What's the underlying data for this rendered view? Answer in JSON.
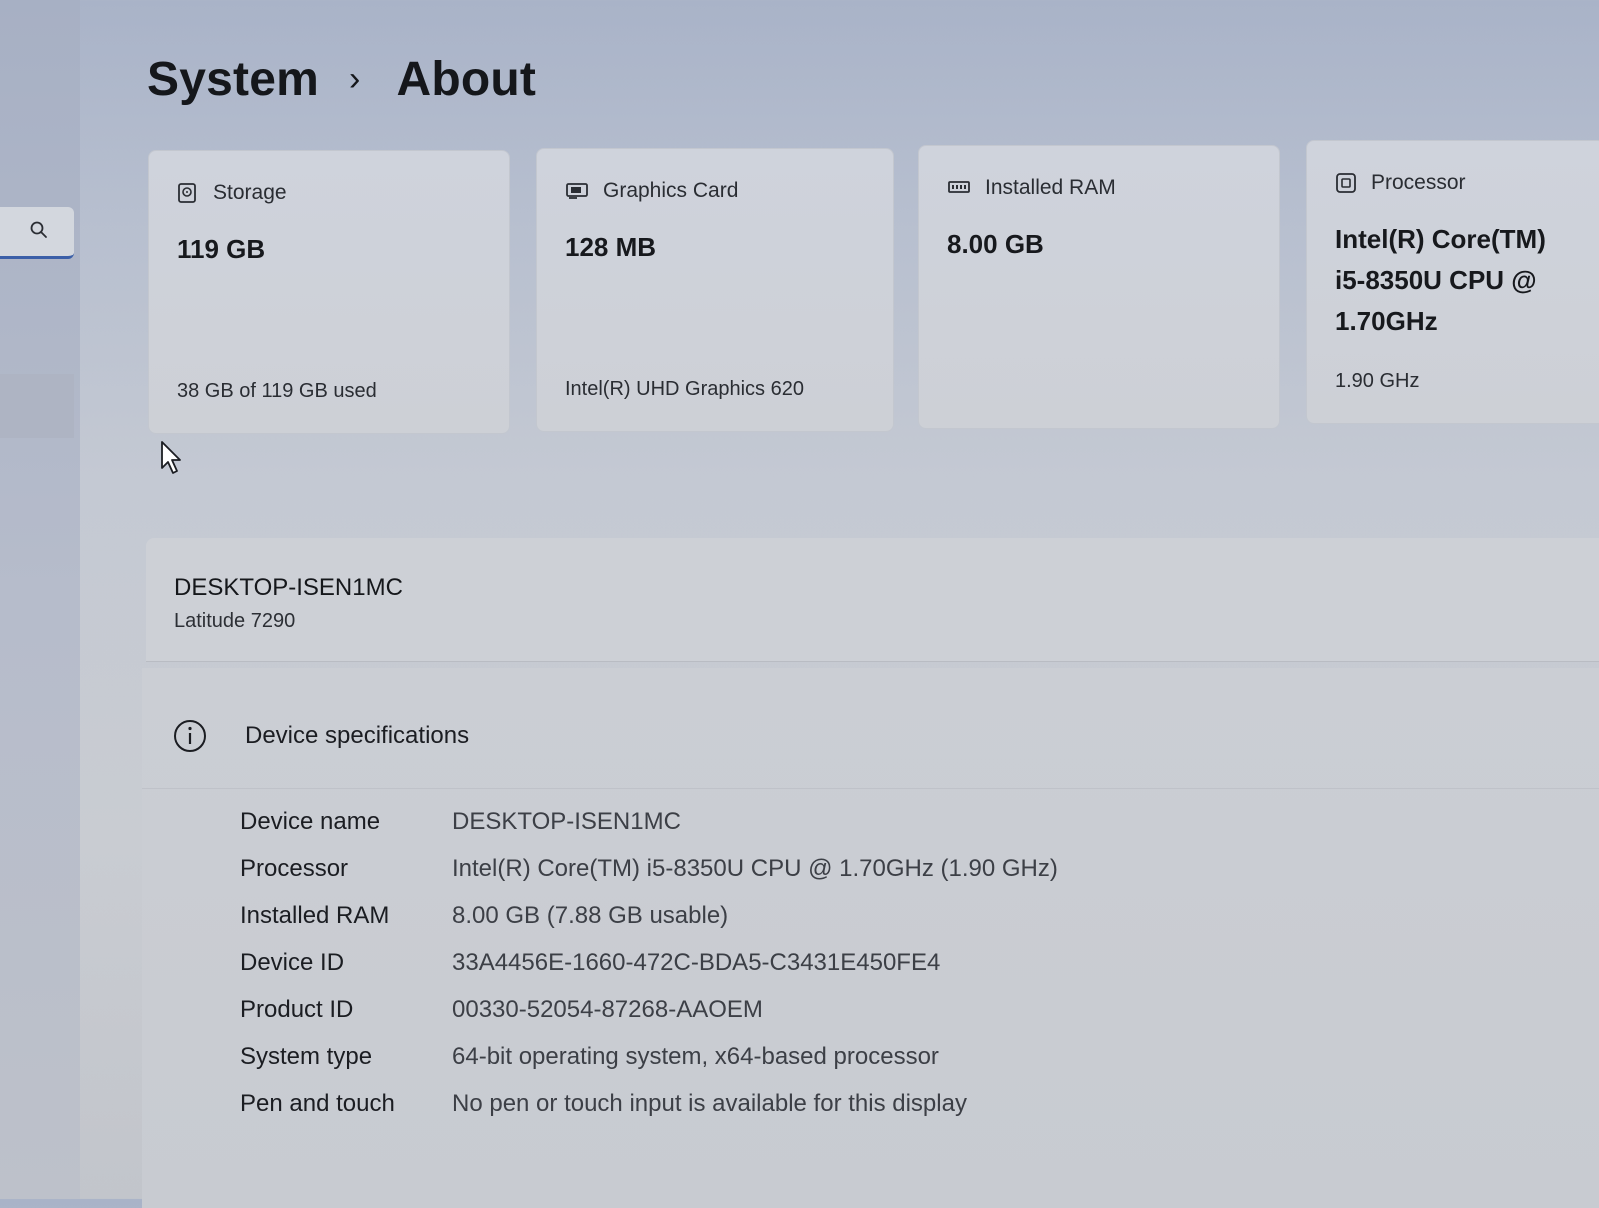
{
  "breadcrumb": {
    "parent": "System",
    "separator": "›",
    "current": "About"
  },
  "cards": {
    "storage": {
      "label": "Storage",
      "value": "119 GB",
      "sub": "38 GB of 119 GB used",
      "icon": "storage-icon"
    },
    "graphics": {
      "label": "Graphics Card",
      "value": "128 MB",
      "sub": "Intel(R) UHD Graphics 620",
      "icon": "graphics-card-icon"
    },
    "ram": {
      "label": "Installed RAM",
      "value": "8.00 GB",
      "icon": "ram-icon"
    },
    "processor": {
      "label": "Processor",
      "value_line1": "Intel(R) Core(TM)",
      "value_line2": "i5-8350U CPU @",
      "value_line3": "1.70GHz",
      "sub": "1.90 GHz",
      "icon": "processor-icon"
    }
  },
  "device": {
    "name": "DESKTOP-ISEN1MC",
    "model": "Latitude 7290"
  },
  "specs": {
    "title": "Device specifications",
    "rows": [
      {
        "label": "Device name",
        "value": "DESKTOP-ISEN1MC"
      },
      {
        "label": "Processor",
        "value": "Intel(R) Core(TM) i5-8350U CPU @ 1.70GHz (1.90 GHz)"
      },
      {
        "label": "Installed RAM",
        "value": "8.00 GB (7.88 GB usable)"
      },
      {
        "label": "Device ID",
        "value": "33A4456E-1660-472C-BDA5-C3431E450FE4"
      },
      {
        "label": "Product ID",
        "value": "00330-52054-87268-AAOEM"
      },
      {
        "label": "System type",
        "value": "64-bit operating system, x64-based processor"
      },
      {
        "label": "Pen and touch",
        "value": "No pen or touch input is available for this display"
      }
    ]
  },
  "colors": {
    "accent": "#3b5fa8"
  }
}
